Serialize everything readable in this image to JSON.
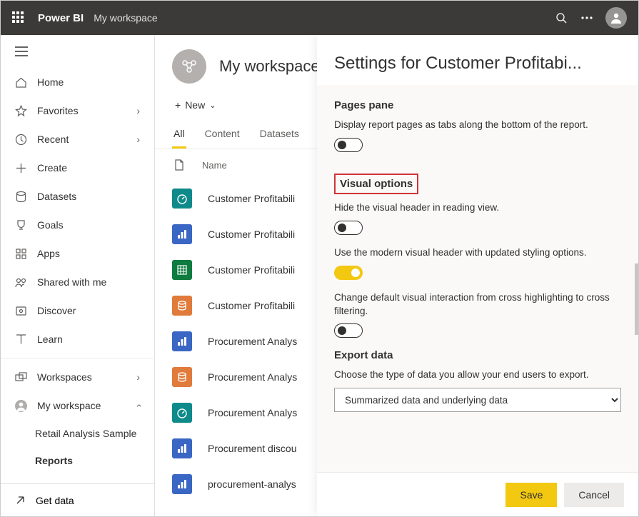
{
  "topbar": {
    "brand": "Power BI",
    "workspace": "My workspace"
  },
  "sidebar": {
    "items": [
      {
        "label": "Home"
      },
      {
        "label": "Favorites",
        "chevron": true
      },
      {
        "label": "Recent",
        "chevron": true
      },
      {
        "label": "Create"
      },
      {
        "label": "Datasets"
      },
      {
        "label": "Goals"
      },
      {
        "label": "Apps"
      },
      {
        "label": "Shared with me"
      },
      {
        "label": "Discover"
      },
      {
        "label": "Learn"
      }
    ],
    "workspaces_label": "Workspaces",
    "my_workspace_label": "My workspace",
    "sub": [
      {
        "label": "Retail Analysis Sample"
      },
      {
        "label": "Reports",
        "bold": true
      }
    ],
    "footer": "Get data"
  },
  "main": {
    "workspace_title": "My workspace",
    "new_label": "New",
    "tabs": [
      "All",
      "Content",
      "Datasets"
    ],
    "active_tab": 0,
    "name_col": "Name",
    "items": [
      {
        "name": "Customer Profitabili",
        "color": "teal",
        "glyph": "dashboard"
      },
      {
        "name": "Customer Profitabili",
        "color": "blue",
        "glyph": "bars"
      },
      {
        "name": "Customer Profitabili",
        "color": "green",
        "glyph": "xls"
      },
      {
        "name": "Customer Profitabili",
        "color": "orange",
        "glyph": "db"
      },
      {
        "name": "Procurement Analys",
        "color": "blue",
        "glyph": "bars"
      },
      {
        "name": "Procurement Analys",
        "color": "orange",
        "glyph": "db"
      },
      {
        "name": "Procurement Analys",
        "color": "teal",
        "glyph": "dashboard"
      },
      {
        "name": "Procurement discou",
        "color": "blue",
        "glyph": "bars"
      },
      {
        "name": "procurement-analys",
        "color": "blue",
        "glyph": "bars"
      }
    ]
  },
  "panel": {
    "title": "Settings for Customer Profitabi...",
    "sections": {
      "pages_pane": {
        "title": "Pages pane",
        "desc": "Display report pages as tabs along the bottom of the report.",
        "on": false
      },
      "visual_options": {
        "title": "Visual options",
        "highlighted": true,
        "opts": [
          {
            "desc": "Hide the visual header in reading view.",
            "on": false
          },
          {
            "desc": "Use the modern visual header with updated styling options.",
            "on": true
          },
          {
            "desc": "Change default visual interaction from cross highlighting to cross filtering.",
            "on": false
          }
        ]
      },
      "export": {
        "title": "Export data",
        "desc": "Choose the type of data you allow your end users to export.",
        "value": "Summarized data and underlying data"
      }
    },
    "save_label": "Save",
    "cancel_label": "Cancel"
  }
}
